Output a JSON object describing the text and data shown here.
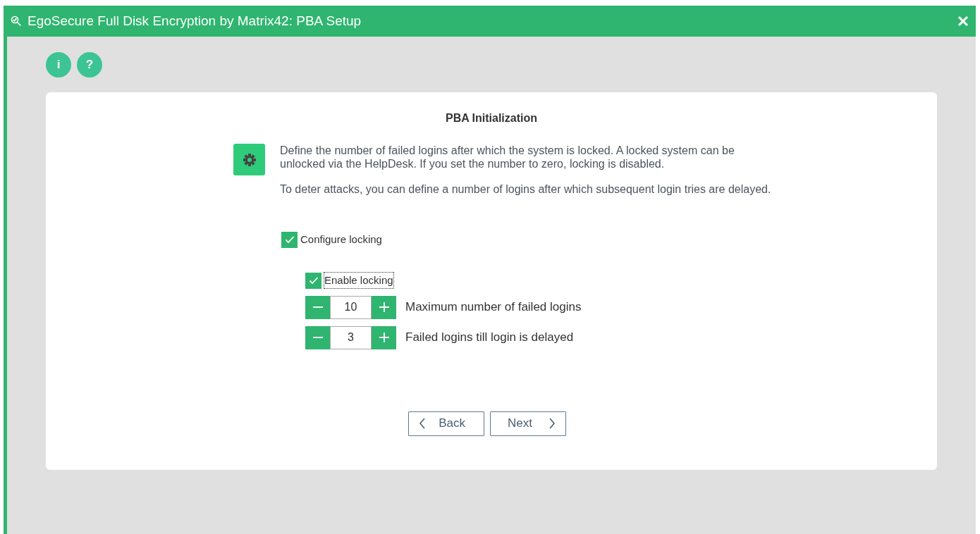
{
  "window": {
    "title": "EgoSecure Full Disk Encryption by Matrix42: PBA Setup"
  },
  "top_buttons": [
    "i",
    "?"
  ],
  "panel": {
    "heading": "PBA Initialization",
    "paragraphs": [
      "Define the number of failed logins after which the system is locked. A locked system can be unlocked via the HelpDesk. If you set the number to zero, locking is disabled.",
      "To deter attacks, you can define a number of logins after which subsequent login tries are delayed."
    ],
    "configure": {
      "label": "Configure locking",
      "checked": true
    },
    "enable": {
      "label": "Enable locking",
      "checked": true,
      "focused": true
    },
    "spinners": [
      {
        "value": "10",
        "label": "Maximum number of failed logins"
      },
      {
        "value": "3",
        "label": "Failed logins till login is delayed"
      }
    ],
    "buttons": [
      {
        "label": "Back",
        "kind": "back"
      },
      {
        "label": "Next",
        "kind": "next"
      }
    ]
  }
}
